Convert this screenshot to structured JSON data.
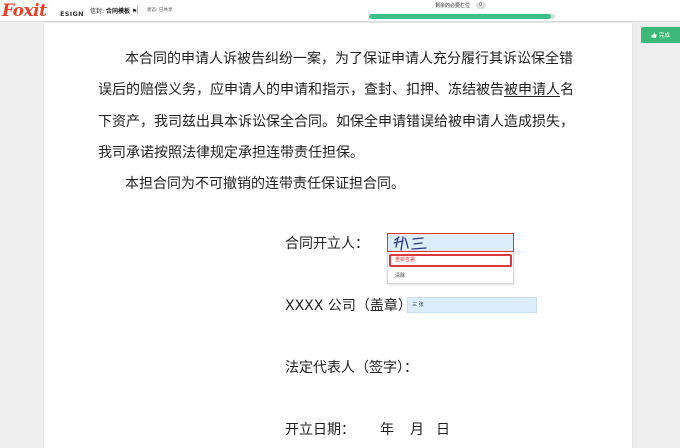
{
  "header": {
    "logo_text": "Foxit",
    "logo_sub": "ESIGN",
    "title_prefix": "信封:",
    "title": "合同模板",
    "status": "状态: 已共享",
    "remaining_label": "剩余的必要栏位",
    "remaining_count": "0",
    "progress_fraction": 0.98,
    "finish_label": "完成"
  },
  "document": {
    "para1": {
      "line1": "本合同的申请人诉被告纠纷一案，为了保证申请人充分履行其诉讼保全错",
      "line2_a": "误后的赔偿义务，应申请人的申请和指示，查封、扣押、冻结被告",
      "line2_b": "被申请人",
      "line2_c": "名",
      "line3": "下资产，我司兹出具本诉讼保全合同。如保全申请错误给被申请人造成损失，",
      "line4": "我司承诺按照法律规定承担连带责任担保。"
    },
    "para2": "本担合同为不可撤销的连带责任保证担合同。",
    "fields": {
      "contractor_label": "合同开立人：",
      "company_label": "XXXX 公司（盖章）",
      "representative_label": "法定代表人（签字）：",
      "date_label": "开立日期：",
      "year": "年",
      "month": "月",
      "day": "日"
    },
    "signature_menu": {
      "resign": "重新签署",
      "clear": "清除"
    },
    "stamp_value": "三 张"
  },
  "colors": {
    "brand": "#e8402a",
    "accent_green": "#3cb878",
    "field_fill": "#dcecf8",
    "error_red": "#e0373f"
  }
}
